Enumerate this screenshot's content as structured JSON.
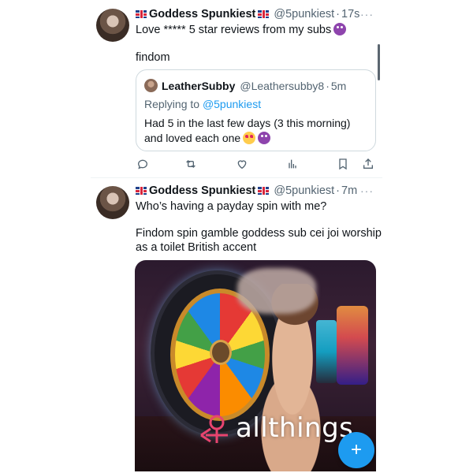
{
  "tweet1": {
    "display_name": "Goddess Spunkiest",
    "handle": "@5punkiest",
    "time": "17s",
    "more": "···",
    "line1": "Love ***** 5 star reviews from my subs",
    "line2": "findom",
    "quote": {
      "display_name": "LeatherSubby",
      "handle": "@Leathersubby8",
      "time": "5m",
      "replying_prefix": "Replying to",
      "replying_handle": "@5punkiest",
      "text1": "Had 5 in the last few days (3 this morning)",
      "text2": "and loved each one"
    }
  },
  "tweet2": {
    "display_name": "Goddess Spunkiest",
    "handle": "@5punkiest",
    "time": "7m",
    "more": "···",
    "line1": "Who’s having a payday spin with me?",
    "line2": "Findom spin gamble goddess sub cei joi worship",
    "line3": "as a toilet British accent",
    "media": {
      "watermark": "allthings"
    }
  },
  "separator": "·",
  "icons": {
    "actions": [
      "reply-icon",
      "retweet-icon",
      "like-icon",
      "views-icon",
      "bookmark-icon",
      "share-icon"
    ],
    "fab": "compose-icon"
  },
  "colors": {
    "accent": "#1d9bf0",
    "text": "#0f1419",
    "muted": "#536471"
  }
}
